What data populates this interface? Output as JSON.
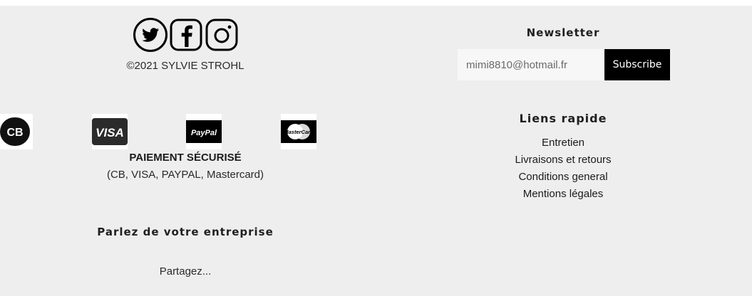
{
  "social": {
    "icons": [
      "twitter-icon",
      "facebook-icon",
      "instagram-icon"
    ]
  },
  "copyright": "©2021 SYLVIE STROHL",
  "payments": {
    "logos": {
      "cb": "CB",
      "visa": "VISA",
      "paypal": "PayPal",
      "mastercard": "MasterCard"
    },
    "title": "PAIEMENT SÉCURISÉ",
    "subtitle": "(CB, VISA, PAYPAL, Mastercard)"
  },
  "about": {
    "title": "Parlez de votre entreprise",
    "text": "Partagez..."
  },
  "newsletter": {
    "title": "Newsletter",
    "email_placeholder": "mimi8810@hotmail.fr",
    "subscribe_label": "Subscribe"
  },
  "quick_links": {
    "title": "Liens rapide",
    "items": [
      {
        "label": "Entretien"
      },
      {
        "label": "Livraisons et retours"
      },
      {
        "label": "Conditions general"
      },
      {
        "label": "Mentions légales"
      }
    ]
  },
  "colors": {
    "footer_bg": "#eeeeee",
    "button_bg": "#000000",
    "button_text": "#ffffff"
  }
}
